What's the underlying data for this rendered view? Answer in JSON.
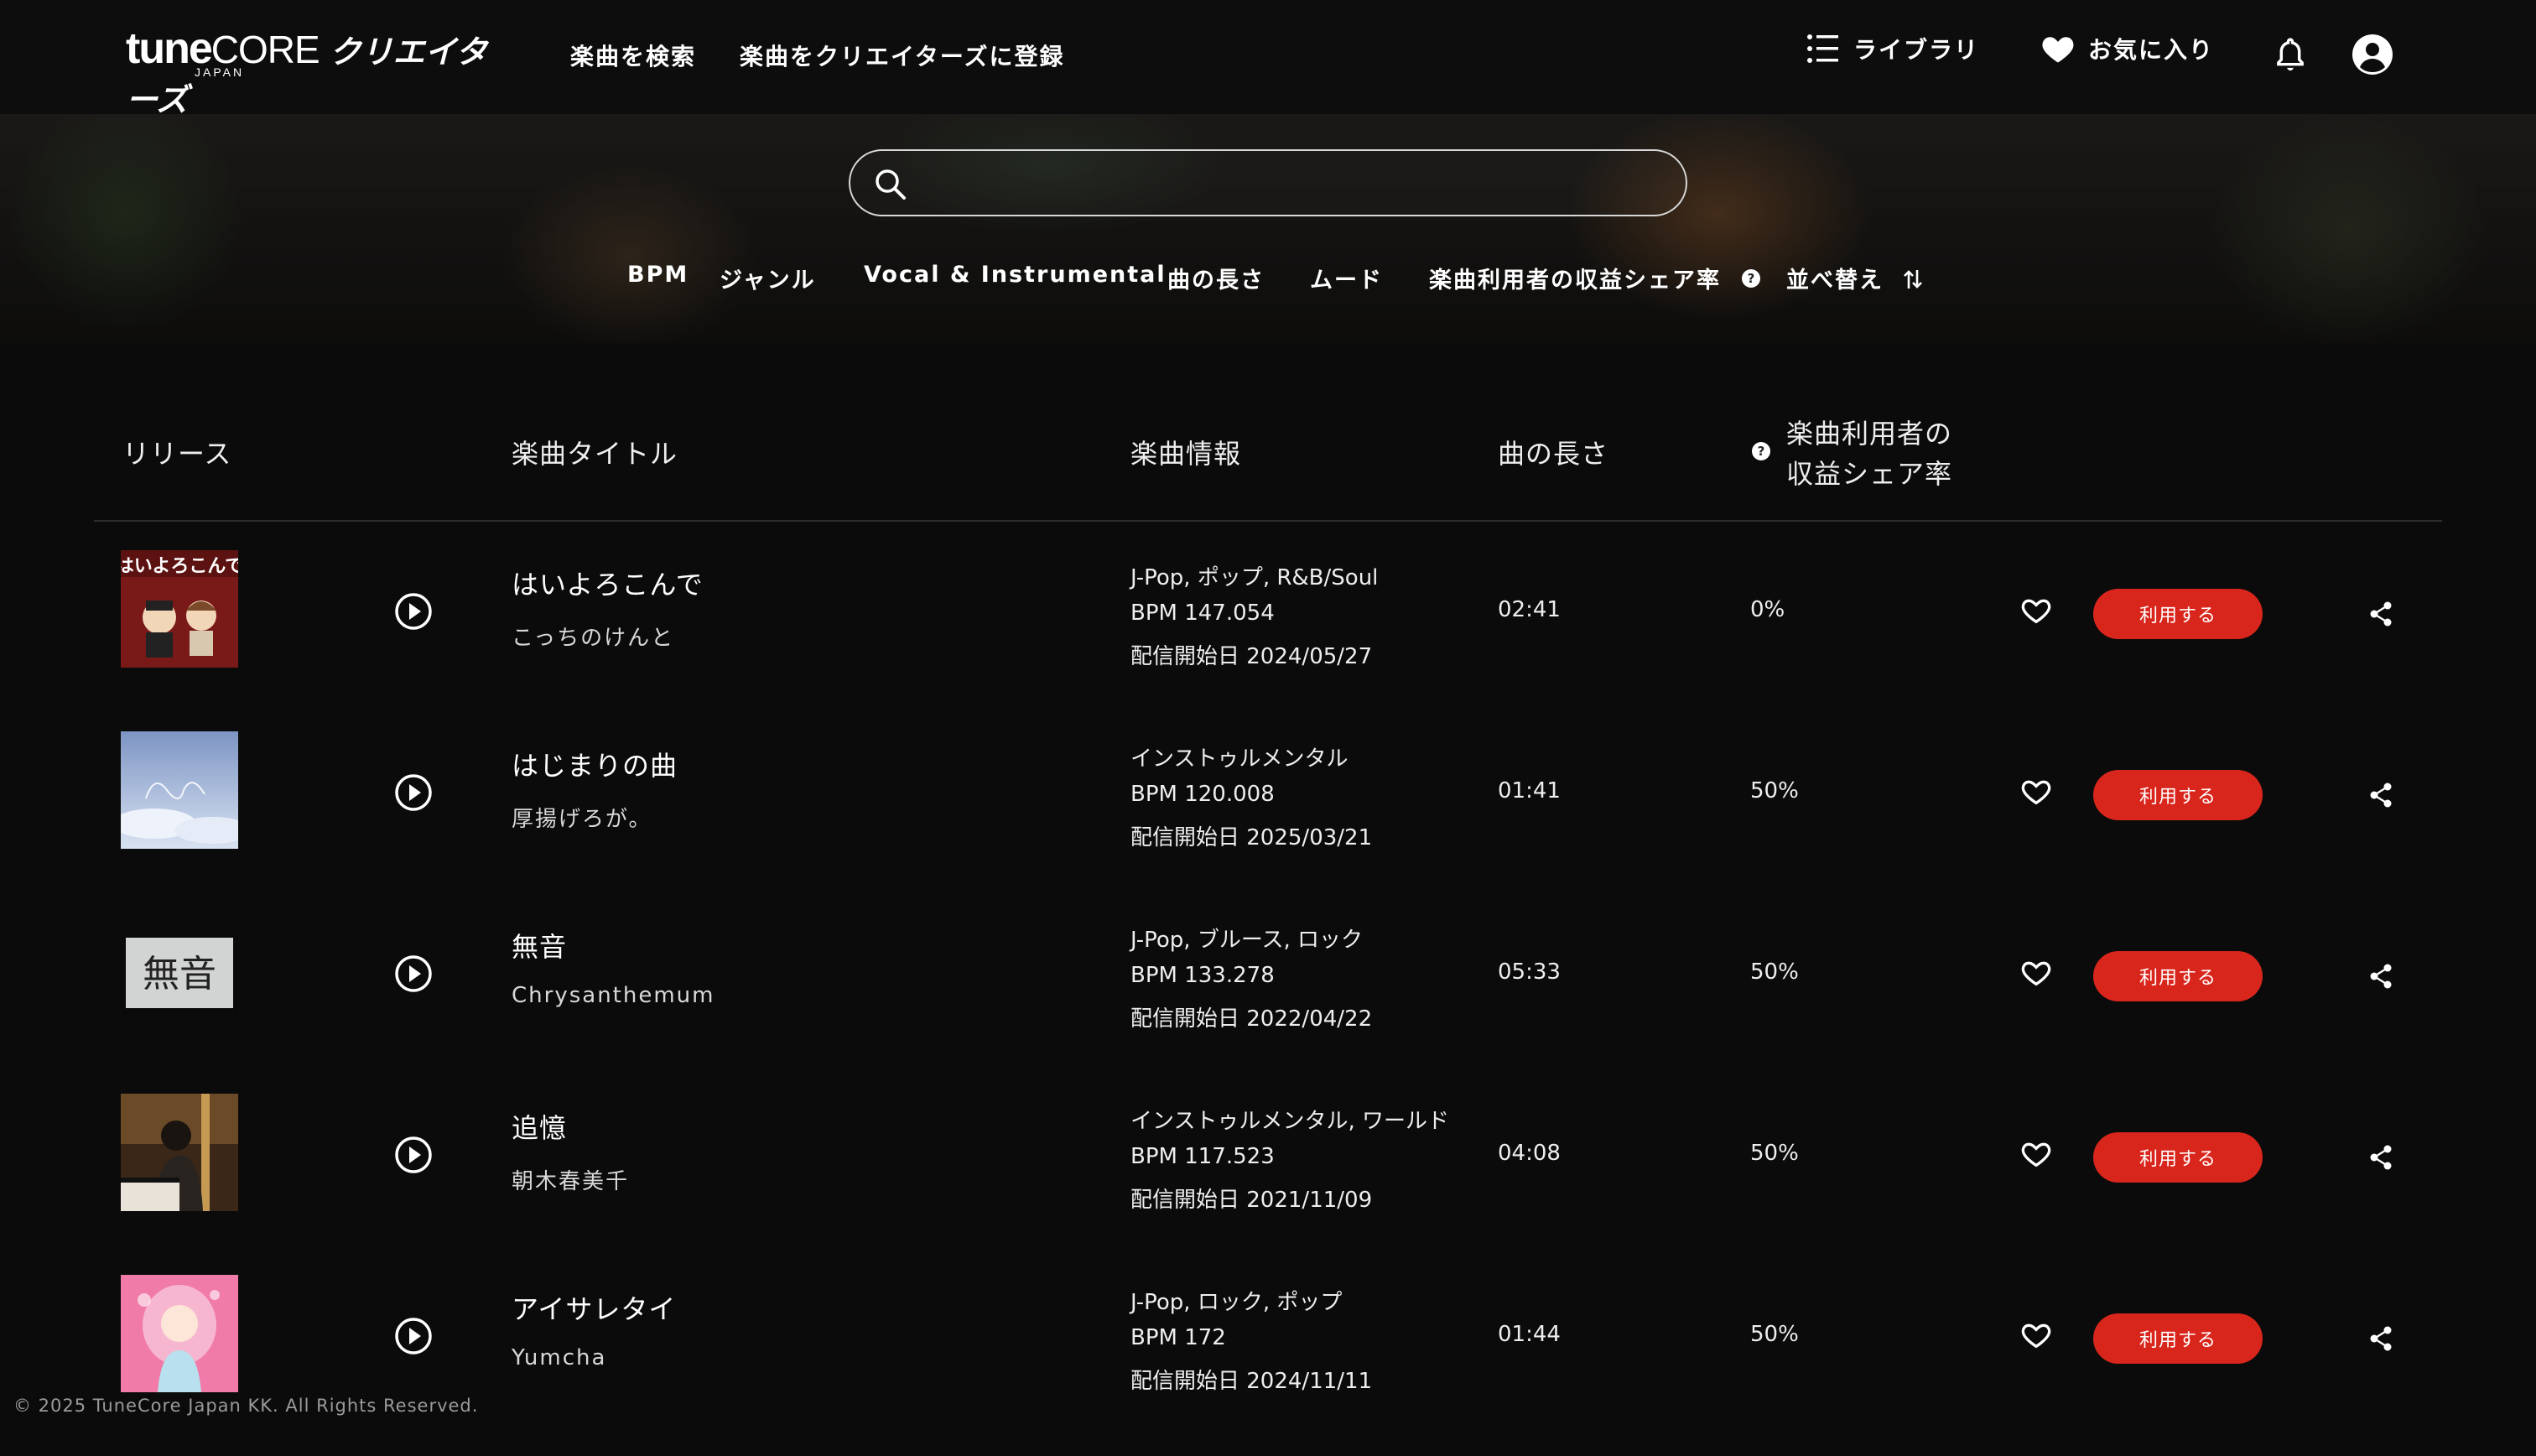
{
  "header": {
    "logo_tune": "tune",
    "logo_core": "CORE",
    "logo_creators": "クリエイターズ",
    "logo_japan": "JAPAN",
    "nav_search": "楽曲を検索",
    "nav_register": "楽曲をクリエイターズに登録",
    "library": "ライブラリ",
    "favorites": "お気に入り"
  },
  "search": {
    "placeholder": "",
    "value": ""
  },
  "filters": {
    "bpm": "BPM",
    "genre": "ジャンル",
    "vocal": "Vocal & Instrumental",
    "length": "曲の長さ",
    "mood": "ムード",
    "revenue_share": "楽曲利用者の収益シェア率",
    "sort": "並べ替え"
  },
  "table": {
    "headers": {
      "release": "リリース",
      "title": "楽曲タイトル",
      "info": "楽曲情報",
      "length": "曲の長さ",
      "share_line1": "楽曲利用者の",
      "share_line2": "収益シェア率"
    },
    "use_label": "利用する",
    "rows": [
      {
        "title": "はいよろこんで",
        "artist": "こっちのけんと",
        "genres": "J-Pop, ポップ, R&B/Soul",
        "bpm": "BPM 147.054",
        "date": "配信開始日 2024/05/27",
        "length": "02:41",
        "share": "0%"
      },
      {
        "title": "はじまりの曲",
        "artist": "厚揚げろが。",
        "genres": "インストゥルメンタル",
        "bpm": "BPM 120.008",
        "date": "配信開始日 2025/03/21",
        "length": "01:41",
        "share": "50%"
      },
      {
        "title": "無音",
        "artist": "Chrysanthemum",
        "genres": "J-Pop, ブルース, ロック",
        "bpm": "BPM 133.278",
        "date": "配信開始日 2022/04/22",
        "length": "05:33",
        "share": "50%"
      },
      {
        "title": "追憶",
        "artist": "朝木春美千",
        "genres": "インストゥルメンタル, ワールド",
        "bpm": "BPM 117.523",
        "date": "配信開始日 2021/11/09",
        "length": "04:08",
        "share": "50%"
      },
      {
        "title": "アイサレタイ",
        "artist": "Yumcha",
        "genres": "J-Pop, ロック, ポップ",
        "bpm": "BPM 172",
        "date": "配信開始日 2024/11/11",
        "length": "01:44",
        "share": "50%"
      }
    ]
  },
  "footer": {
    "copyright": "© 2025 TuneCore Japan KK. All Rights Reserved."
  },
  "colors": {
    "accent": "#d9261c",
    "background": "#0b0b0b"
  }
}
